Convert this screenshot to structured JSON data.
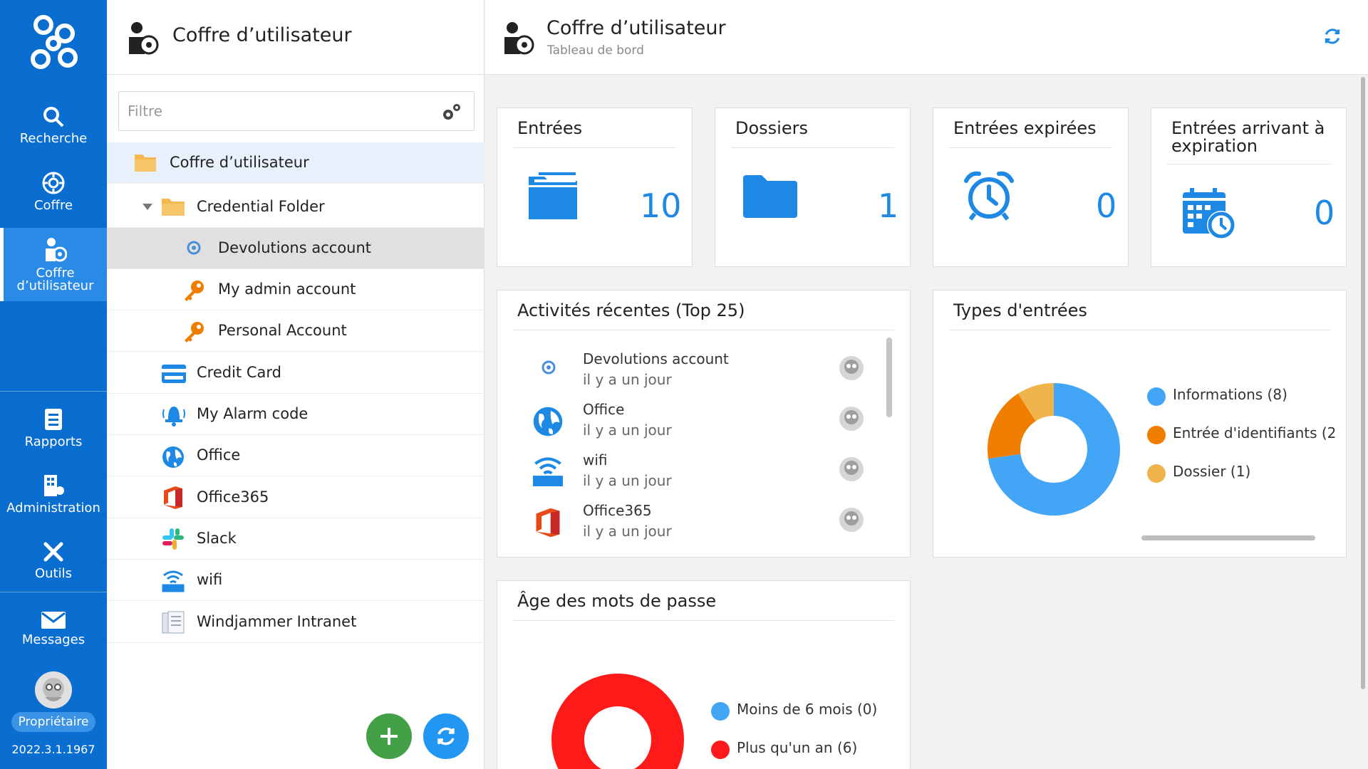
{
  "nav": {
    "items": [
      {
        "label": "Recherche",
        "icon": "search-icon"
      },
      {
        "label": "Coffre",
        "icon": "vault-icon"
      },
      {
        "label": "Coffre\nd’utilisateur",
        "label_l1": "Coffre",
        "label_l2": "d’utilisateur",
        "icon": "user-vault-icon"
      },
      {
        "label": "Rapports",
        "icon": "report-icon"
      },
      {
        "label": "Administration",
        "icon": "administration-icon"
      },
      {
        "label": "Outils",
        "icon": "tools-icon"
      },
      {
        "label": "Messages",
        "icon": "envelope-icon"
      }
    ],
    "owner_badge": "Propriétaire",
    "version": "2022.3.1.1967"
  },
  "tree": {
    "title": "Coffre d’utilisateur",
    "filter_placeholder": "Filtre",
    "items": [
      {
        "label": "Coffre d’utilisateur",
        "icon": "folder-icon"
      },
      {
        "label": "Credential Folder",
        "icon": "folder-icon"
      },
      {
        "label": "Devolutions account",
        "icon": "devolutions-icon"
      },
      {
        "label": "My admin account",
        "icon": "key-icon"
      },
      {
        "label": "Personal Account",
        "icon": "key-icon"
      },
      {
        "label": "Credit Card",
        "icon": "credit-card-icon"
      },
      {
        "label": "My Alarm code",
        "icon": "alarm-bell-icon"
      },
      {
        "label": "Office",
        "icon": "globe-icon"
      },
      {
        "label": "Office365",
        "icon": "office365-icon"
      },
      {
        "label": "Slack",
        "icon": "slack-icon"
      },
      {
        "label": "wifi",
        "icon": "wifi-router-icon"
      },
      {
        "label": "Windjammer Intranet",
        "icon": "document-icon"
      }
    ]
  },
  "header": {
    "title": "Coffre d’utilisateur",
    "subtitle": "Tableau de bord"
  },
  "stats": [
    {
      "title": "Entrées",
      "value": "10",
      "icon": "folder-stack-icon"
    },
    {
      "title": "Dossiers",
      "value": "1",
      "icon": "folder-icon"
    },
    {
      "title": "Entrées expirées",
      "value": "0",
      "icon": "alarm-clock-icon"
    },
    {
      "title": "Entrées arrivant à expiration",
      "title_l1": "Entrées arrivant à",
      "title_l2": "expiration",
      "value": "0",
      "icon": "calendar-clock-icon"
    }
  ],
  "activities": {
    "title": "Activités récentes (Top 25)",
    "items": [
      {
        "name": "Devolutions account",
        "time": "il y a un jour",
        "icon": "devolutions-icon"
      },
      {
        "name": "Office",
        "time": "il y a un jour",
        "icon": "globe-icon"
      },
      {
        "name": "wifi",
        "time": "il y a un jour",
        "icon": "wifi-router-icon"
      },
      {
        "name": "Office365",
        "time": "il y a un jour",
        "icon": "office365-icon"
      }
    ]
  },
  "entry_types": {
    "title": "Types d'entrées",
    "legend": [
      {
        "label": "Informations (8)",
        "color": "#42a5f5"
      },
      {
        "label": "Entrée d'identifiants (2",
        "color": "#ef7d00"
      },
      {
        "label": "Dossier (1)",
        "color": "#f0b44c"
      }
    ]
  },
  "password_age": {
    "title": "Âge des mots de passe",
    "legend": [
      {
        "label": "Moins de 6 mois (0)",
        "color": "#42a5f5"
      },
      {
        "label": "Plus qu'un an (6)",
        "color": "#ff1a1a"
      }
    ]
  },
  "chart_data": [
    {
      "type": "pie",
      "title": "Types d'entrées",
      "donut": true,
      "labels": [
        "Informations",
        "Entrée d'identifiants",
        "Dossier"
      ],
      "values": [
        8,
        2,
        1
      ],
      "colors": [
        "#42a5f5",
        "#ef7d00",
        "#f0b44c"
      ]
    },
    {
      "type": "pie",
      "title": "Âge des mots de passe",
      "donut": true,
      "labels": [
        "Moins de 6 mois",
        "Plus qu'un an"
      ],
      "values": [
        0,
        6
      ],
      "colors": [
        "#42a5f5",
        "#ff1a1a"
      ]
    }
  ]
}
